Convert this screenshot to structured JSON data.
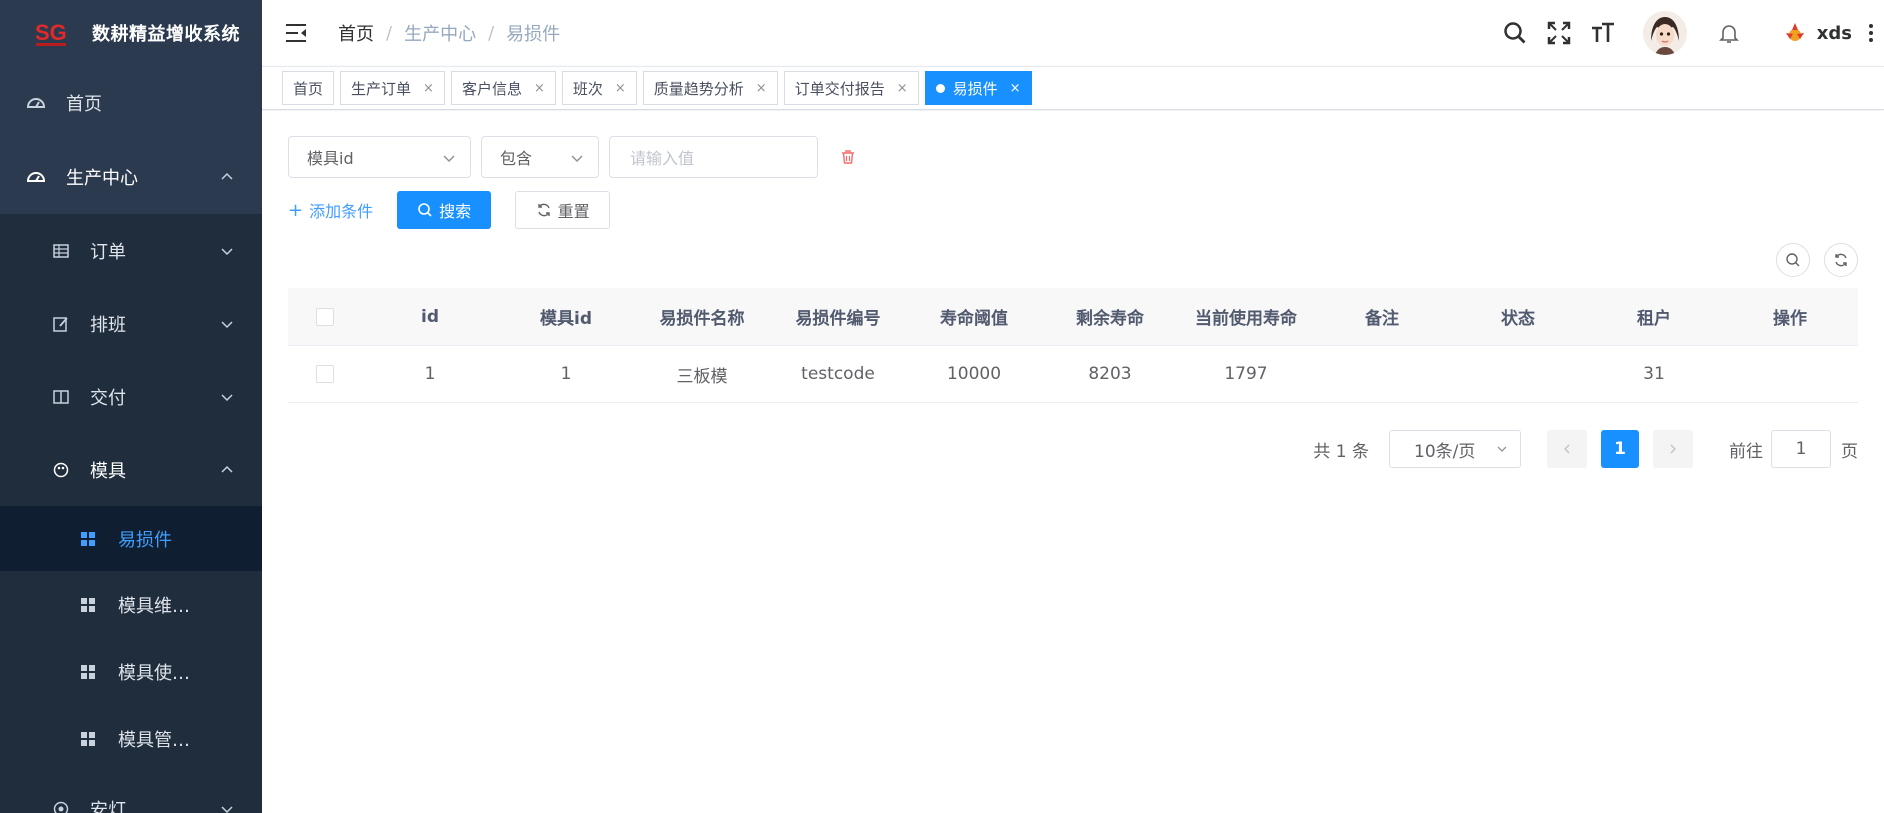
{
  "app": {
    "logo_text": "SG",
    "title": "数耕精益增收系统"
  },
  "sidebar": {
    "home": "首页",
    "production": "生产中心",
    "order": "订单",
    "schedule": "排班",
    "delivery": "交付",
    "mold": "模具",
    "mold_children": [
      "易损件",
      "模具维…",
      "模具使…",
      "模具管…"
    ],
    "andon": "安灯"
  },
  "header": {
    "breadcrumb": [
      "首页",
      "生产中心",
      "易损件"
    ],
    "breadcrumb_sep": "/",
    "username": "xds"
  },
  "tabs": [
    {
      "label": "首页",
      "closable": false,
      "active": false
    },
    {
      "label": "生产订单",
      "closable": true,
      "active": false
    },
    {
      "label": "客户信息",
      "closable": true,
      "active": false
    },
    {
      "label": "班次",
      "closable": true,
      "active": false
    },
    {
      "label": "质量趋势分析",
      "closable": true,
      "active": false
    },
    {
      "label": "订单交付报告",
      "closable": true,
      "active": false
    },
    {
      "label": "易损件",
      "closable": true,
      "active": true
    }
  ],
  "tab_close": "×",
  "filter": {
    "field": "模具id",
    "operator": "包含",
    "value_placeholder": "请输入值",
    "add_condition": "添加条件",
    "search": "搜索",
    "reset": "重置"
  },
  "table": {
    "columns": [
      "id",
      "模具id",
      "易损件名称",
      "易损件编号",
      "寿命阈值",
      "剩余寿命",
      "当前使用寿命",
      "备注",
      "状态",
      "租户",
      "操作"
    ],
    "rows": [
      [
        "1",
        "1",
        "三板模",
        "testcode",
        "10000",
        "8203",
        "1797",
        "",
        "",
        "31",
        ""
      ]
    ]
  },
  "pagination": {
    "total": "共 1 条",
    "page_size": "10条/页",
    "current": "1",
    "goto_label": "前往",
    "goto_value": "1",
    "page_unit": "页"
  },
  "colors": {
    "primary": "#1890ff",
    "sidebar_bg": "#2b3a4f",
    "submenu_bg": "#1f2d3d",
    "active_item_bg": "#0f1e30",
    "danger": "#f56c6c"
  }
}
